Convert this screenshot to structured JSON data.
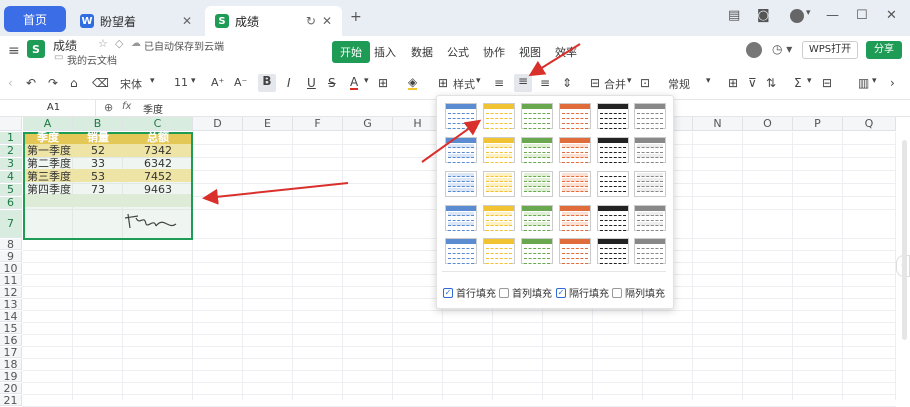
{
  "tabs": {
    "home": "首页",
    "doc": "盼望着",
    "sheet": "成绩",
    "doc_badge": "W",
    "sheet_badge": "S"
  },
  "menu": {
    "filename": "成绩",
    "saved": "已自动保存到云端",
    "location": "我的云文档",
    "items": [
      "开始",
      "插入",
      "数据",
      "公式",
      "协作",
      "视图",
      "效率"
    ],
    "wps_open": "WPS打开",
    "share": "分享"
  },
  "toolbar": {
    "font": "宋体",
    "size": "11",
    "style_label": "样式",
    "merge_label": "合并",
    "numfmt": "常规"
  },
  "formula": {
    "cellref": "A1",
    "fx": "fx",
    "value": "季度"
  },
  "columns": [
    "A",
    "B",
    "C",
    "D",
    "E",
    "F",
    "G",
    "H",
    "I",
    "J",
    "K",
    "L",
    "M",
    "N",
    "O",
    "P",
    "Q"
  ],
  "rows": [
    "1",
    "2",
    "3",
    "4",
    "5",
    "6",
    "7",
    "8",
    "9",
    "10",
    "11",
    "12",
    "13",
    "14",
    "15",
    "16",
    "17",
    "18",
    "19",
    "20",
    "21"
  ],
  "table": {
    "header": [
      "季度",
      "销量",
      "总额"
    ],
    "data": [
      [
        "第一季度",
        "52",
        "7342"
      ],
      [
        "第二季度",
        "33",
        "6342"
      ],
      [
        "第三季度",
        "53",
        "7452"
      ],
      [
        "第四季度",
        "73",
        "9463"
      ]
    ],
    "signature": "签名"
  },
  "panel": {
    "options": [
      {
        "label": "首行填充",
        "checked": true
      },
      {
        "label": "首列填充",
        "checked": false
      },
      {
        "label": "隔行填充",
        "checked": true
      },
      {
        "label": "隔列填充",
        "checked": false
      }
    ]
  },
  "colors": {
    "accent": "#3b6de6",
    "green": "#1e9b55",
    "header_fill": "#f1c232",
    "band": "#fce79b",
    "arrow": "#d9302c"
  }
}
